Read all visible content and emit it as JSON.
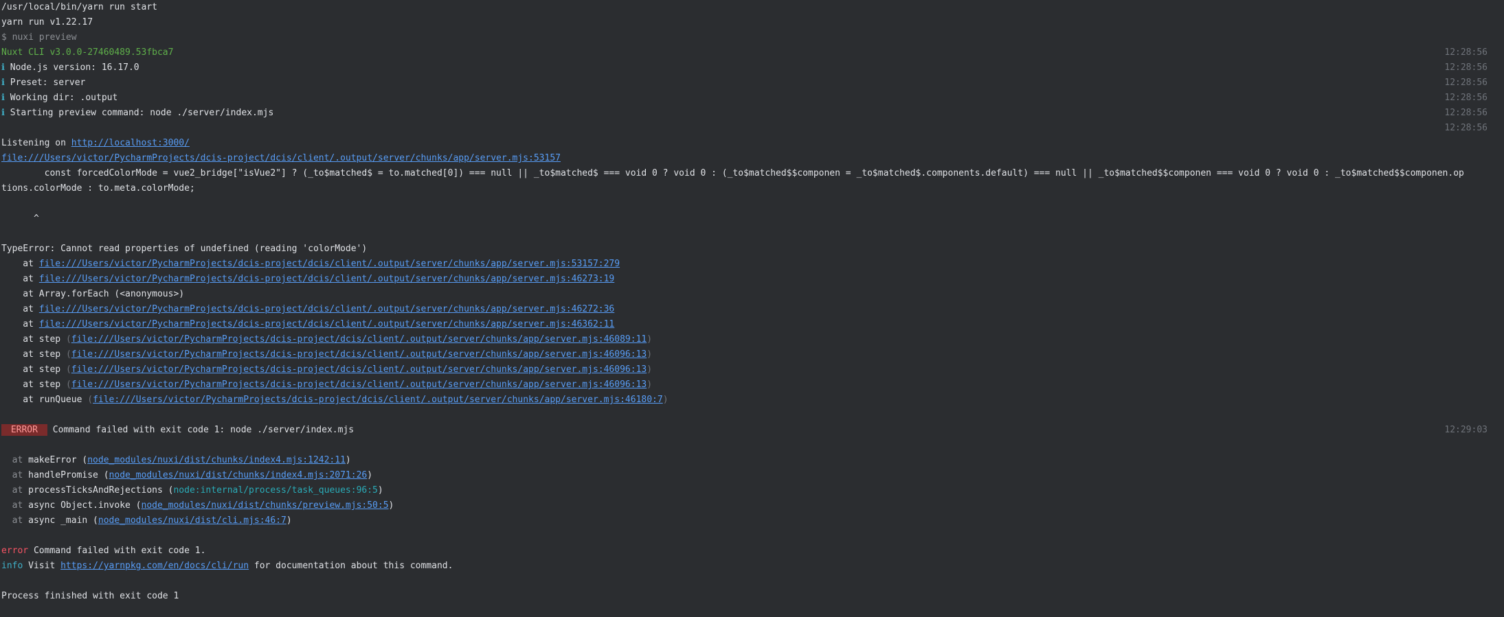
{
  "console": {
    "cmd_path": "/usr/local/bin/yarn run start",
    "yarn_version": "yarn run v1.22.17",
    "preview_cmd": "$ nuxi preview",
    "cli_version": "Nuxt CLI v3.0.0-27460489.53fbca7",
    "info_icon": "ℹ",
    "info_lines": [
      "Node.js version: 16.17.0",
      "Preset: server",
      "Working dir: .output",
      "Starting preview command: node ./server/index.mjs"
    ],
    "timestamp_start": "12:28:56",
    "listening_label": "Listening on",
    "listening_url": "http://localhost:3000/",
    "source_link": "file:///Users/victor/PycharmProjects/dcis-project/dcis/client/.output/server/chunks/app/server.mjs:53157",
    "code_line_1": "        const forcedColorMode = vue2_bridge[\"isVue2\"] ? (_to$matched$ = to.matched[0]) === null || _to$matched$ === void 0 ? void 0 : (_to$matched$$componen = _to$matched$.components.default) === null || _to$matched$$componen === void 0 ? void 0 : _to$matched$$componen.op",
    "code_line_2": "tions.colorMode : to.meta.colorMode;",
    "caret": "      ^",
    "type_error": "TypeError: Cannot read properties of undefined (reading 'colorMode')",
    "stack": [
      {
        "at": "    at ",
        "fn": "",
        "link": "file:///Users/victor/PycharmProjects/dcis-project/dcis/client/.output/server/chunks/app/server.mjs:53157:279",
        "paren": false
      },
      {
        "at": "    at ",
        "fn": "",
        "link": "file:///Users/victor/PycharmProjects/dcis-project/dcis/client/.output/server/chunks/app/server.mjs:46273:19",
        "paren": false
      },
      {
        "at": "    at ",
        "fn": "Array.forEach (<anonymous>)",
        "link": "",
        "paren": false
      },
      {
        "at": "    at ",
        "fn": "",
        "link": "file:///Users/victor/PycharmProjects/dcis-project/dcis/client/.output/server/chunks/app/server.mjs:46272:36",
        "paren": false
      },
      {
        "at": "    at ",
        "fn": "",
        "link": "file:///Users/victor/PycharmProjects/dcis-project/dcis/client/.output/server/chunks/app/server.mjs:46362:11",
        "paren": false
      },
      {
        "at": "    at ",
        "fn": "step ",
        "link": "file:///Users/victor/PycharmProjects/dcis-project/dcis/client/.output/server/chunks/app/server.mjs:46089:11",
        "paren": true
      },
      {
        "at": "    at ",
        "fn": "step ",
        "link": "file:///Users/victor/PycharmProjects/dcis-project/dcis/client/.output/server/chunks/app/server.mjs:46096:13",
        "paren": true
      },
      {
        "at": "    at ",
        "fn": "step ",
        "link": "file:///Users/victor/PycharmProjects/dcis-project/dcis/client/.output/server/chunks/app/server.mjs:46096:13",
        "paren": true
      },
      {
        "at": "    at ",
        "fn": "step ",
        "link": "file:///Users/victor/PycharmProjects/dcis-project/dcis/client/.output/server/chunks/app/server.mjs:46096:13",
        "paren": true
      },
      {
        "at": "    at ",
        "fn": "runQueue ",
        "link": "file:///Users/victor/PycharmProjects/dcis-project/dcis/client/.output/server/chunks/app/server.mjs:46180:7",
        "paren": true
      }
    ],
    "error_badge": " ERROR ",
    "error_message": "Command failed with exit code 1: node ./server/index.mjs",
    "timestamp_error": "12:29:03",
    "nuxi_stack": [
      {
        "at": "  at ",
        "fn": "makeError (",
        "link": "node_modules/nuxi/dist/chunks/index4.mjs:1242:11",
        "close": ")",
        "internal": false
      },
      {
        "at": "  at ",
        "fn": "handlePromise (",
        "link": "node_modules/nuxi/dist/chunks/index4.mjs:2071:26",
        "close": ")",
        "internal": false
      },
      {
        "at": "  at ",
        "fn": "processTicksAndRejections (",
        "link": "node:internal/process/task_queues:96:5",
        "close": ")",
        "internal": true
      },
      {
        "at": "  at ",
        "fn": "async Object.invoke (",
        "link": "node_modules/nuxi/dist/chunks/preview.mjs:50:5",
        "close": ")",
        "internal": false
      },
      {
        "at": "  at ",
        "fn": "async _main (",
        "link": "node_modules/nuxi/dist/cli.mjs:46:7",
        "close": ")",
        "internal": false
      }
    ],
    "error_word": "error",
    "error_text": " Command failed with exit code 1.",
    "info_word": "info",
    "info_visit": " Visit ",
    "docs_url": "https://yarnpkg.com/en/docs/cli/run",
    "info_tail": " for documentation about this command.",
    "process_finished": "Process finished with exit code 1"
  },
  "colors": {
    "background": "#2b2d30",
    "text": "#dfe1e5",
    "link": "#589df6",
    "success": "#5fb04a",
    "error": "#f75464",
    "badge_bg": "#7a2b2b"
  }
}
